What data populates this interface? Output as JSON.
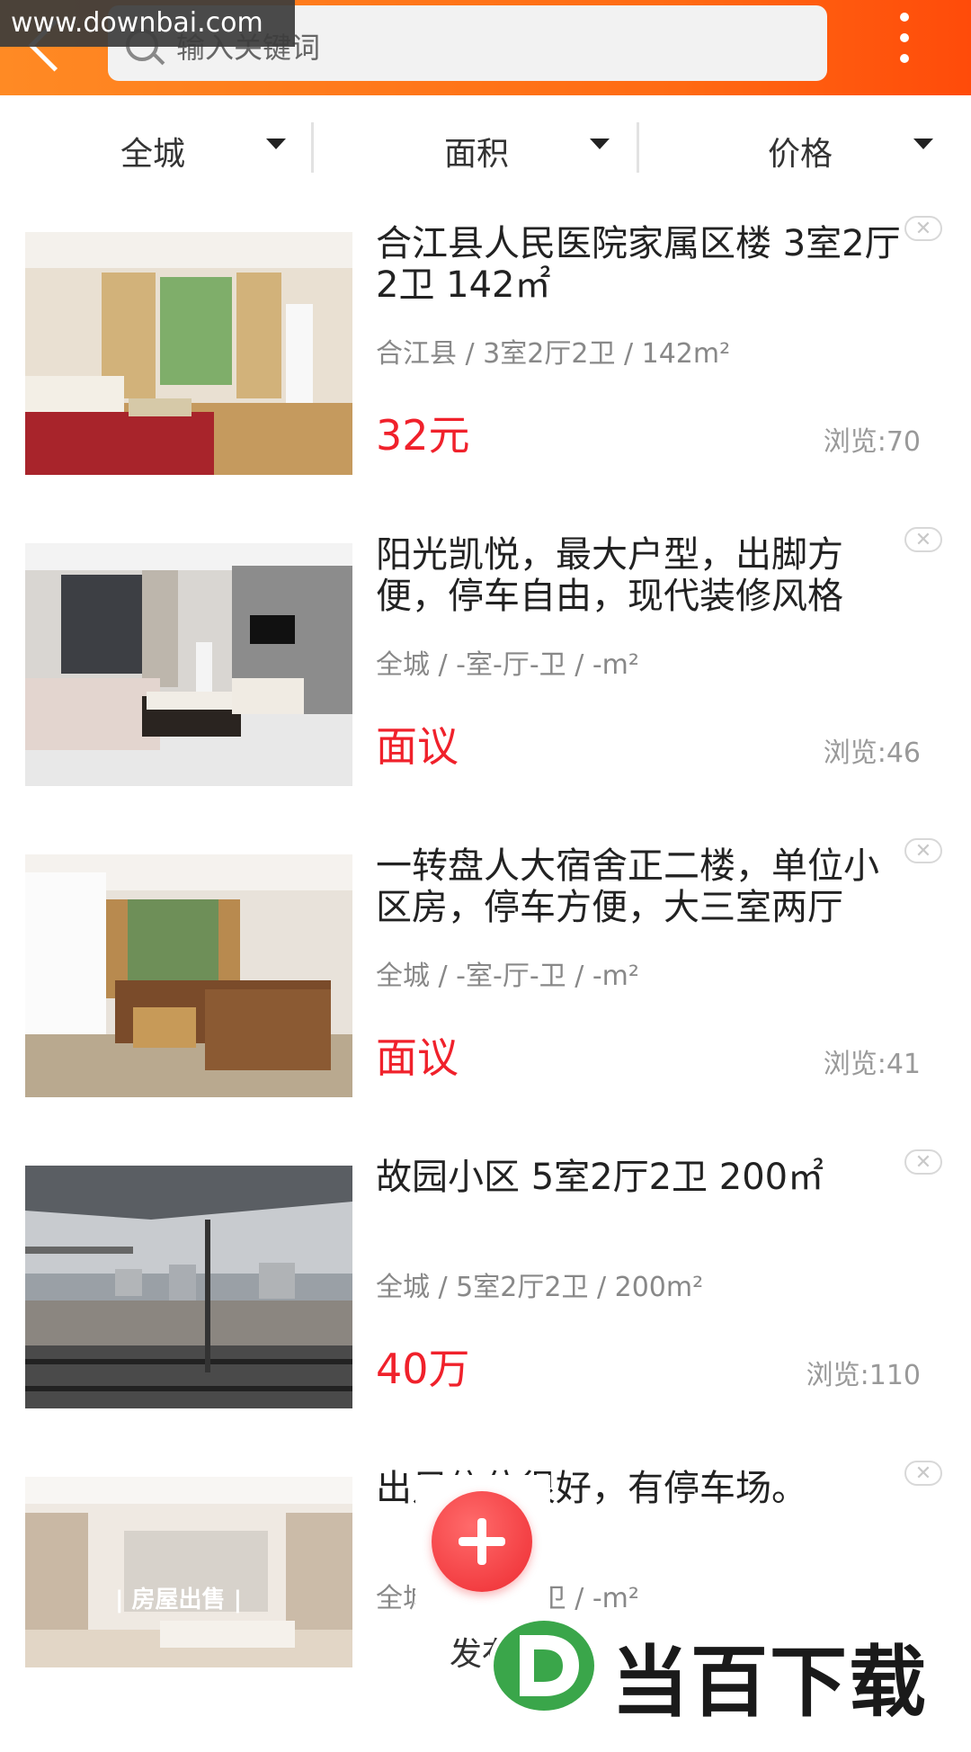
{
  "watermark": {
    "url": "www.downbai.com",
    "brand": "当百下载"
  },
  "header": {
    "search_placeholder": "输入关键词"
  },
  "filters": [
    {
      "label": "全城"
    },
    {
      "label": "面积"
    },
    {
      "label": "价格"
    }
  ],
  "listings": [
    {
      "title": "合江县人民医院家属区楼 3室2厅2卫 142㎡",
      "meta": "合江县 / 3室2厅2卫 / 142m²",
      "price": "32元",
      "views": "浏览:70"
    },
    {
      "title": "阳光凯悦，最大户型，出脚方便，停车自由，现代装修风格",
      "meta": "全城 / -室-厅-卫 / -m²",
      "price": "面议",
      "views": "浏览:46"
    },
    {
      "title": "一转盘人大宿舍正二楼，单位小区房，停车方便，大三室两厅",
      "meta": "全城 / -室-厅-卫 / -m²",
      "price": "面议",
      "views": "浏览:41"
    },
    {
      "title": "故园小区 5室2厅2卫 200㎡",
      "meta": "全城 / 5室2厅2卫 / 200m²",
      "price": "40万",
      "views": "浏览:110"
    },
    {
      "title": "出足信位很好，有停车场。",
      "meta": "全城 / -室-厅-卫 / -m²",
      "price": "",
      "views": "",
      "photo_caption": "| 房屋出售 |"
    }
  ],
  "fab": {
    "label": "发布"
  },
  "colors": {
    "header_orange": "#ff6a13",
    "price_red": "#f0212b",
    "fab_red": "#ee2b31"
  }
}
